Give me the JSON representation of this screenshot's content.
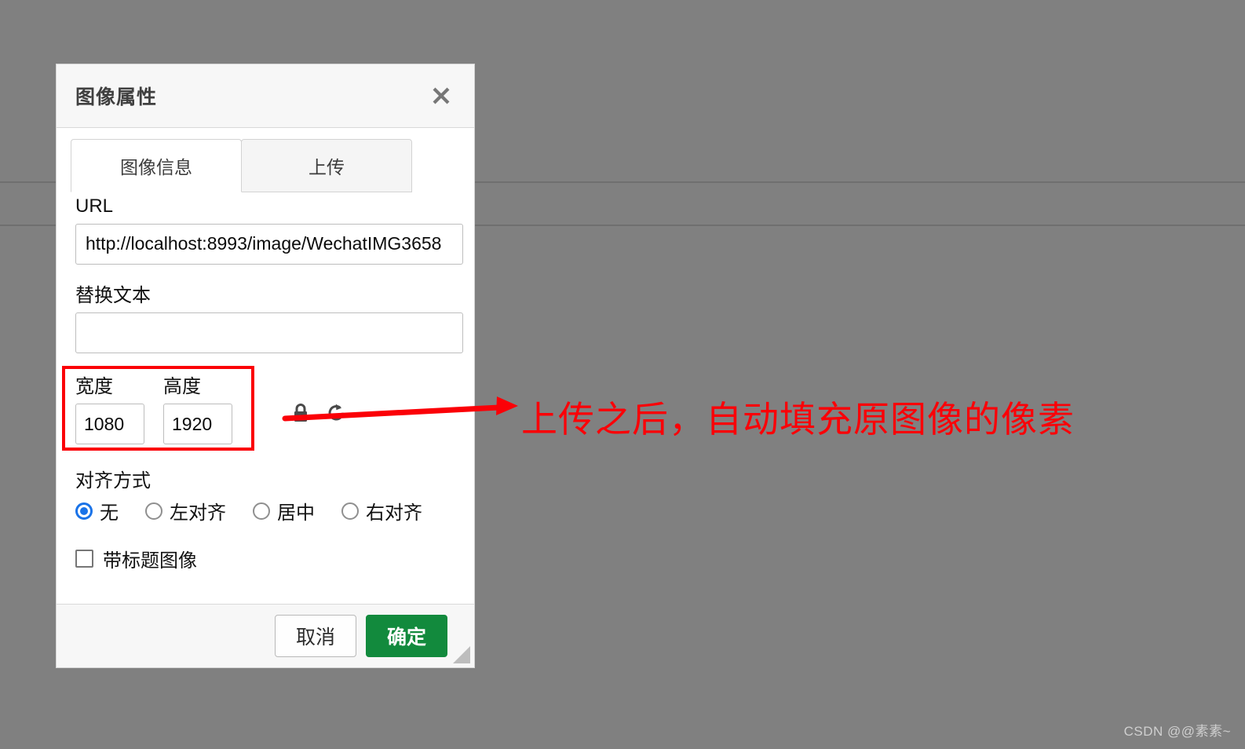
{
  "background": {
    "color": "#808080",
    "line_color": "#6f6f6f"
  },
  "dialog": {
    "title": "图像属性",
    "close_icon": "close-icon",
    "tabs": [
      {
        "label": "图像信息",
        "active": true
      },
      {
        "label": "上传",
        "active": false
      }
    ],
    "fields": {
      "url_label": "URL",
      "url_value": "http://localhost:8993/image/WechatIMG3658",
      "alt_label": "替换文本",
      "alt_value": "",
      "width_label": "宽度",
      "width_value": "1080",
      "height_label": "高度",
      "height_value": "1920",
      "lock_icon": "lock-icon",
      "reset_icon": "reset-icon"
    },
    "align": {
      "title": "对齐方式",
      "options": [
        {
          "label": "无",
          "checked": true
        },
        {
          "label": "左对齐",
          "checked": false
        },
        {
          "label": "居中",
          "checked": false
        },
        {
          "label": "右对齐",
          "checked": false
        }
      ]
    },
    "caption_checkbox": {
      "label": "带标题图像",
      "checked": false
    },
    "footer": {
      "cancel_label": "取消",
      "ok_label": "确定",
      "ok_color": "#128a3d",
      "resize_grip_icon": "resize-grip-icon"
    }
  },
  "annotation": {
    "text": "上传之后，自动填充原图像的像素",
    "color": "#fb0007",
    "arrow_icon": "arrow-right-icon",
    "highlight_box_color": "#fb0007"
  },
  "watermark": {
    "text": "CSDN @@素素~"
  }
}
